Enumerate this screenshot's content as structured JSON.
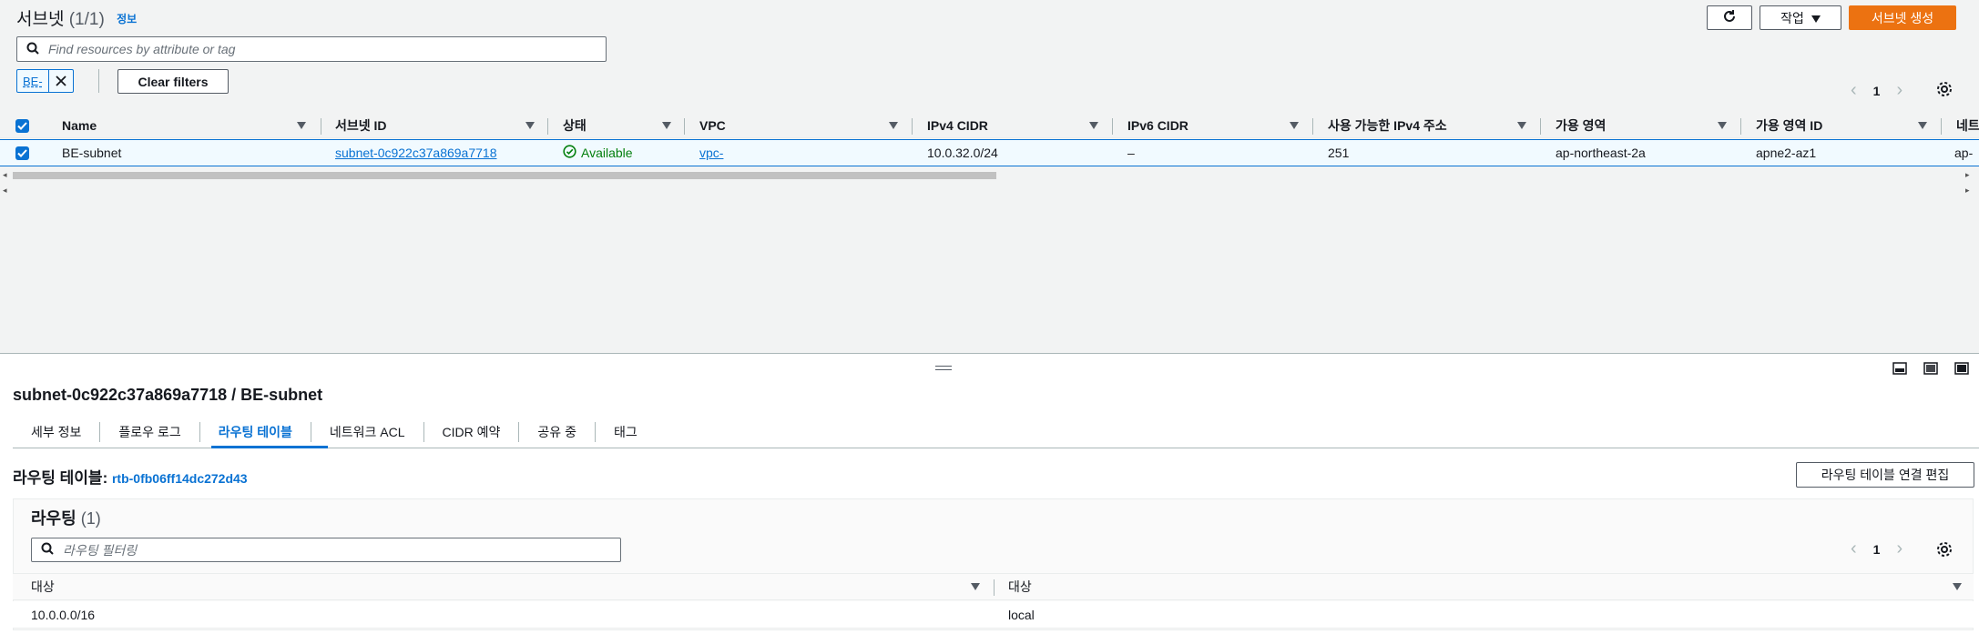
{
  "header": {
    "title": "서브넷",
    "count": "(1/1)",
    "info": "정보",
    "actions_label": "작업",
    "create_label": "서브넷 생성",
    "refresh_icon": "refresh-icon"
  },
  "filter": {
    "placeholder": "Find resources by attribute or tag",
    "token": "BE-",
    "clear_label": "Clear filters"
  },
  "pagination": {
    "page": "1"
  },
  "table": {
    "columns": [
      "Name",
      "서브넷 ID",
      "상태",
      "VPC",
      "IPv4 CIDR",
      "IPv6 CIDR",
      "사용 가능한 IPv4 주소",
      "가용 영역",
      "가용 영역 ID",
      "네트"
    ],
    "row": {
      "name": "BE-subnet",
      "subnet_id": "subnet-0c922c37a869a7718",
      "status": "Available",
      "vpc": "vpc-",
      "ipv4": "10.0.32.0/24",
      "ipv6": "–",
      "available_ips": "251",
      "az": "ap-northeast-2a",
      "az_id": "apne2-az1",
      "network": "ap-"
    }
  },
  "detail": {
    "title": "subnet-0c922c37a869a7718 / BE-subnet",
    "tabs": [
      "세부 정보",
      "플로우 로그",
      "라우팅 테이블",
      "네트워크 ACL",
      "CIDR 예약",
      "공유 중",
      "태그"
    ],
    "active_tab": 2,
    "route_table_label": "라우팅 테이블:",
    "route_table_id": "rtb-0fb06ff14dc272d43",
    "edit_assoc_label": "라우팅 테이블 연결 편집"
  },
  "routes": {
    "title": "라우팅",
    "count": "(1)",
    "filter_placeholder": "라우팅 필터링",
    "page": "1",
    "columns": [
      "대상",
      "대상"
    ],
    "rows": [
      {
        "destination": "10.0.0.0/16",
        "target": "local"
      }
    ]
  },
  "colors": {
    "accent": "#0972d3",
    "primary_button": "#ec7211",
    "success": "#037f0c"
  }
}
